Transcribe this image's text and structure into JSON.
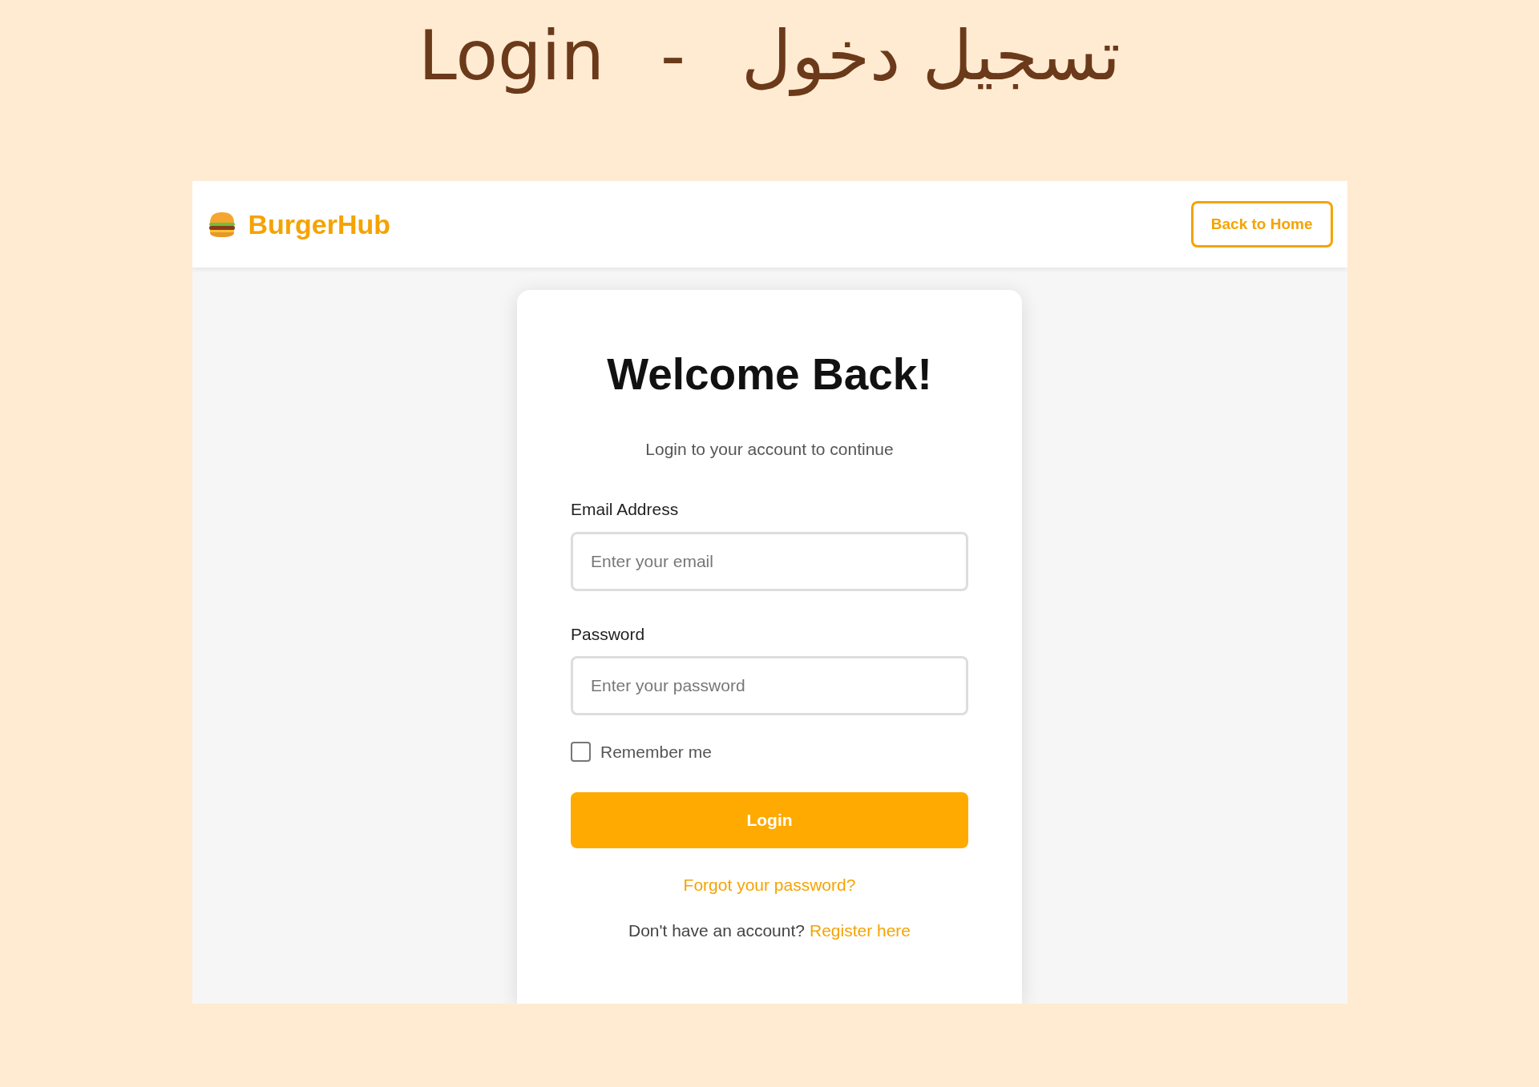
{
  "headline": {
    "english": "Login",
    "separator": "-",
    "arabic": "تسجيل دخول"
  },
  "header": {
    "brand": "BurgerHub",
    "back_button": "Back to Home"
  },
  "card": {
    "title": "Welcome Back!",
    "subtitle": "Login to your account to continue",
    "fields": [
      {
        "label": "Email Address",
        "placeholder": "Enter your email"
      },
      {
        "label": "Password",
        "placeholder": "Enter your password"
      }
    ],
    "remember": {
      "label": "Remember me",
      "checked": false
    },
    "login_button": "Login",
    "forgot_link": "Forgot your password?",
    "register": {
      "prompt": "Don't have an account?",
      "link": "Register here"
    }
  }
}
